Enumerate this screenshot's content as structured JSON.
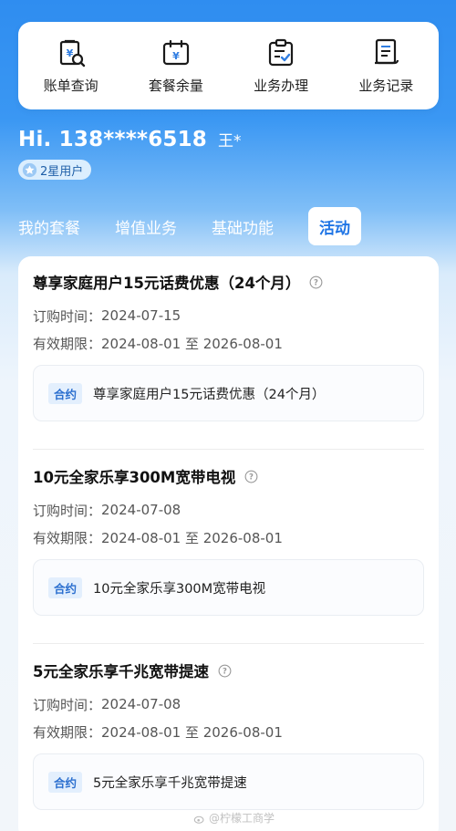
{
  "quick_actions": [
    {
      "label": "账单查询",
      "icon": "bill-search-icon"
    },
    {
      "label": "套餐余量",
      "icon": "calendar-yen-icon"
    },
    {
      "label": "业务办理",
      "icon": "clipboard-check-icon"
    },
    {
      "label": "业务记录",
      "icon": "document-record-icon"
    }
  ],
  "user": {
    "phone": "Hi. 138****6518",
    "name": "王*",
    "level": "2星用户"
  },
  "tabs": [
    "我的套餐",
    "增值业务",
    "基础功能",
    "活动"
  ],
  "active_tab": "活动",
  "activities": [
    {
      "title": "尊享家庭用户15元话费优惠（24个月）",
      "order_label": "订购时间：",
      "order_date": "2024-07-15",
      "valid_label": "有效期限：",
      "valid_range": "2024-08-01 至 2026-08-01",
      "tag": "合约",
      "contract": "尊享家庭用户15元话费优惠（24个月）"
    },
    {
      "title": "10元全家乐享300M宽带电视",
      "order_label": "订购时间：",
      "order_date": "2024-07-08",
      "valid_label": "有效期限：",
      "valid_range": "2024-08-01 至 2026-08-01",
      "tag": "合约",
      "contract": "10元全家乐享300M宽带电视"
    },
    {
      "title": "5元全家乐享千兆宽带提速",
      "order_label": "订购时间：",
      "order_date": "2024-07-08",
      "valid_label": "有效期限：",
      "valid_range": "2024-08-01 至 2026-08-01",
      "tag": "合约",
      "contract": "5元全家乐享千兆宽带提速"
    }
  ],
  "watermark": "@柠檬工商学",
  "colors": {
    "accent": "#1e74e5",
    "header_blue": "#2f8df0",
    "tag_bg": "#e3effd"
  }
}
